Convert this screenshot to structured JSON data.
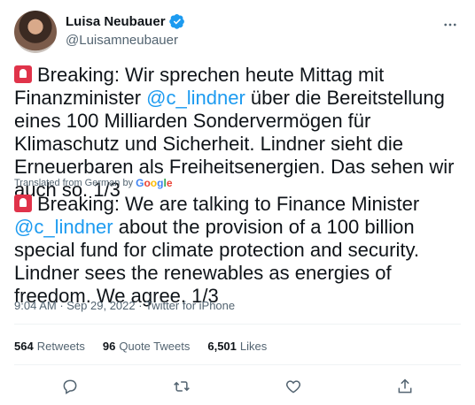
{
  "author": {
    "name": "Luisa Neubauer",
    "handle": "@Luisamneubauer"
  },
  "tweet": {
    "original_before_mention": "Breaking: Wir sprechen heute Mittag mit Finanzminister ",
    "original_mention": "@c_lindner",
    "original_after_mention": " über die Bereitstellung eines 100 Milliarden Sondervermögen für Klimaschutz und Sicherheit. Lindner sieht die Erneuerbaren als Freiheitsenergien. Das sehen wir auch so. 1/3",
    "translated_note": "Translated from German by",
    "translator": "Google",
    "translation_before_mention": "Breaking: We are talking to Finance Minister ",
    "translation_mention": "@c_lindner",
    "translation_after_mention": " about the provision of a 100 billion special fund for climate protection and security. Lindner sees the renewables as energies of freedom. We agree. 1/3"
  },
  "meta": {
    "time": "9:04 AM",
    "separator": " · ",
    "date": "Sep 29, 2022",
    "source": "Twitter for iPhone"
  },
  "stats": {
    "retweets_count": "564",
    "retweets_label": "Retweets",
    "quotes_count": "96",
    "quotes_label": "Quote Tweets",
    "likes_count": "6,501",
    "likes_label": "Likes"
  },
  "colors": {
    "link": "#1d9bf0",
    "secondary_text": "#536471",
    "siren": "#e0334a"
  }
}
